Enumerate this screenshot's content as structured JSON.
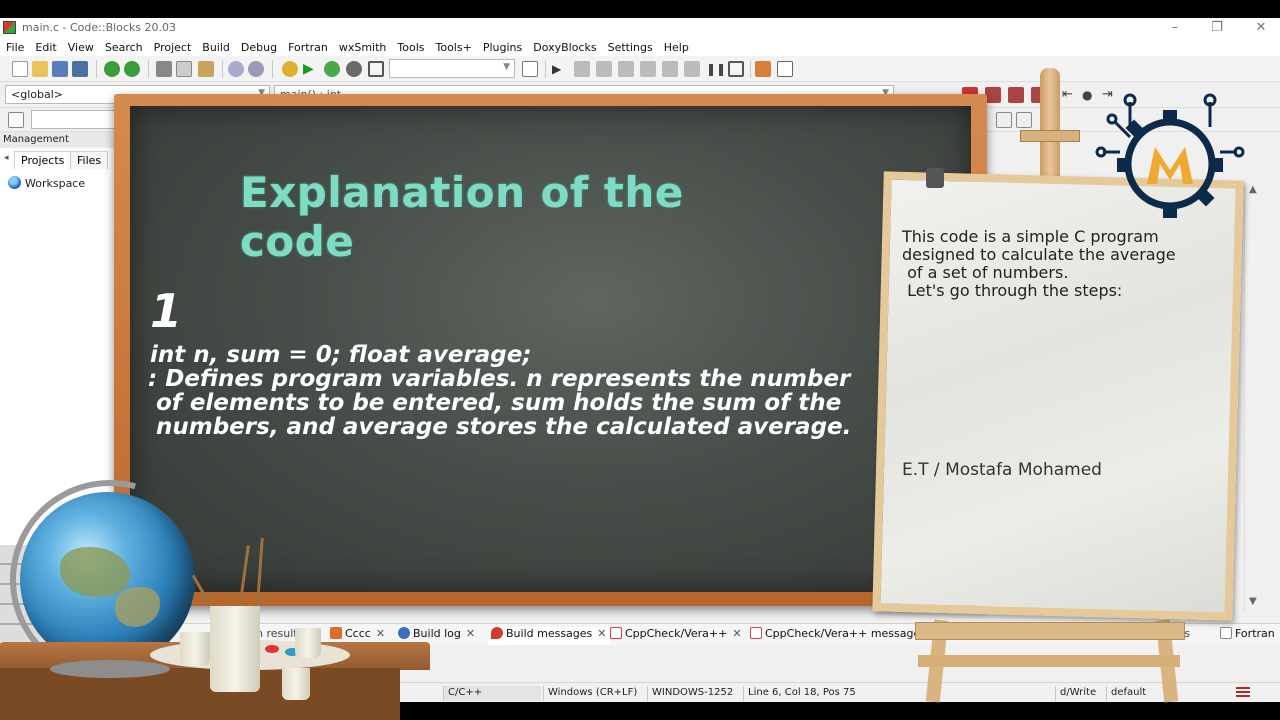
{
  "window": {
    "title": "main.c - Code::Blocks 20.03",
    "controls": [
      "–",
      "❐",
      "✕"
    ]
  },
  "menu": [
    "File",
    "Edit",
    "View",
    "Search",
    "Project",
    "Build",
    "Debug",
    "Fortran",
    "wxSmith",
    "Tools",
    "Tools+",
    "Plugins",
    "DoxyBlocks",
    "Settings",
    "Help"
  ],
  "toolbar": {
    "scope_combo": "<global>",
    "symbol_combo": "main() : int"
  },
  "management": {
    "header": "Management",
    "tabs": [
      "Projects",
      "Files"
    ],
    "workspace": "Workspace"
  },
  "log_tabs": [
    {
      "label": "Cccc",
      "icon": "cccc-icon"
    },
    {
      "label": "Build log",
      "icon": "gear-icon"
    },
    {
      "label": "Build messages",
      "icon": "pin-icon"
    },
    {
      "label": "CppCheck/Vera++",
      "icon": "document-icon"
    },
    {
      "label": "CppCheck/Vera++ messages",
      "icon": "document-icon"
    }
  ],
  "log_tab_partial": {
    "left": "h result",
    "right1": "ts",
    "right2": "Fortran"
  },
  "statusbar": {
    "lang": "C/C++",
    "eol": "Windows (CR+LF)",
    "encoding": "WINDOWS-1252",
    "position": "Line 6, Col 18, Pos 75",
    "mode": "d/Write",
    "profile": "default"
  },
  "board": {
    "title": "Explanation of the code",
    "step": "1",
    "code": "int n, sum = 0; float average;",
    "explanation_lines": [
      ": Defines program variables. n represents the number",
      " of elements to be entered, sum holds the sum of the",
      " numbers, and average stores the calculated average."
    ]
  },
  "paper": {
    "lines": [
      "This code is a simple C program",
      "designed to calculate the average",
      " of a set of numbers.",
      " Let's go through the steps:"
    ],
    "signature": "E.T / Mostafa Mohamed"
  },
  "colors": {
    "board_title": "#7fdcc4",
    "board_bg": "#474d48",
    "frame": "#c87638",
    "logo_navy": "#0e2a4a",
    "logo_gold": "#f0a830"
  }
}
